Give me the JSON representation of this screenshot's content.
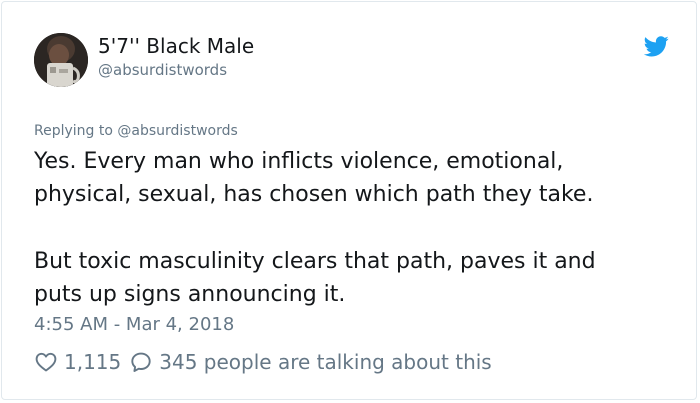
{
  "user": {
    "display_name": "5'7'' Black Male",
    "handle": "@absurdistwords"
  },
  "reply": {
    "prefix": "Replying to ",
    "mention": "@absurdistwords"
  },
  "tweet": {
    "lines_p1": [
      "Yes. Every man who inflicts violence, emotional,",
      "physical, sexual, has chosen which path they take."
    ],
    "lines_p2": [
      "But toxic masculinity clears that path, paves it and",
      "puts up signs announcing it."
    ],
    "timestamp": "4:55 AM - Mar 4, 2018"
  },
  "actions": {
    "like_count": "1,115",
    "talking_text": "345 people are talking about this"
  },
  "icons": {
    "brand": "twitter-bird-icon",
    "like": "heart-icon",
    "reply": "speech-bubble-icon"
  },
  "colors": {
    "brand_blue": "#1da1f2",
    "text_primary": "#14171a",
    "text_secondary": "#657786",
    "border": "#e1e8ed"
  }
}
